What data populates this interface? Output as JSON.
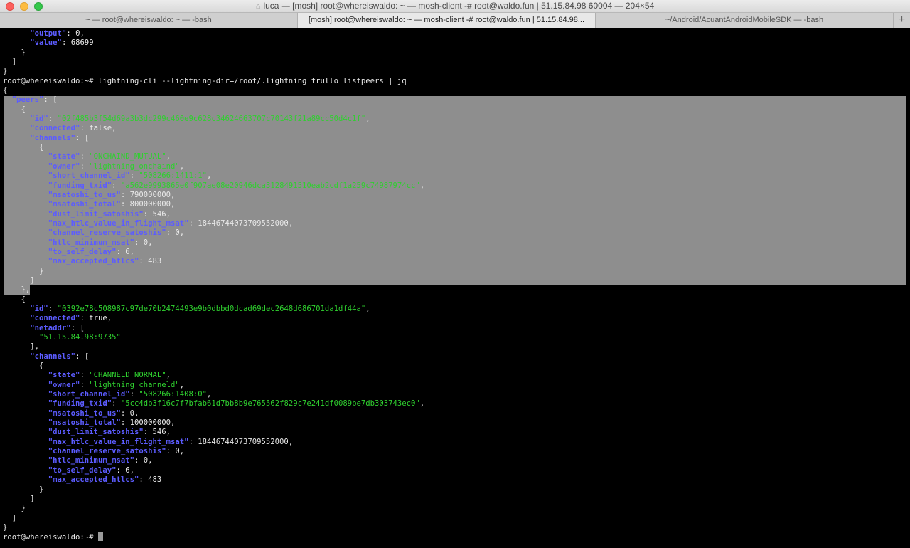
{
  "window": {
    "title": "luca — [mosh] root@whereiswaldo: ~ — mosh-client -# root@waldo.fun | 51.15.84.98 60004 — 204×54"
  },
  "tabs": [
    {
      "label": "~ — root@whereiswaldo: ~ — -bash",
      "active": false
    },
    {
      "label": "[mosh] root@whereiswaldo: ~ — mosh-client -# root@waldo.fun | 51.15.84.98...",
      "active": true
    },
    {
      "label": "~/Android/AcuantAndroidMobileSDK — -bash",
      "active": false
    }
  ],
  "new_tab_label": "+",
  "icons": {
    "title": "home-icon",
    "cursor": "block-cursor"
  },
  "colors": {
    "key": "#5c5cff",
    "string": "#2fd02f",
    "selection": "#8e8e8e"
  },
  "terminal": {
    "lines": [
      [
        {
          "t": "      "
        },
        {
          "t": "\"output\"",
          "c": "k"
        },
        {
          "t": ": 0,"
        }
      ],
      [
        {
          "t": "      "
        },
        {
          "t": "\"value\"",
          "c": "k"
        },
        {
          "t": ": 68699"
        }
      ],
      [
        {
          "t": "    }"
        }
      ],
      [
        {
          "t": "  ]"
        }
      ],
      [
        {
          "t": "}"
        }
      ],
      [
        {
          "t": "root@whereiswaldo:~# lightning-cli --lightning-dir=/root/.lightning_trullo listpeers | jq"
        }
      ],
      [
        {
          "t": "{"
        }
      ],
      [
        {
          "t": "  "
        },
        {
          "t": "\"peers\"",
          "c": "k"
        },
        {
          "t": ": ["
        }
      ],
      [
        {
          "t": "    {"
        }
      ],
      [
        {
          "t": "      "
        },
        {
          "t": "\"id\"",
          "c": "k"
        },
        {
          "t": ": "
        },
        {
          "t": "\"02f485b3f54d69a3b3dc299c460e9c628c34624663707c70143f21a89cc50d4c1f\"",
          "c": "s"
        },
        {
          "t": ","
        }
      ],
      [
        {
          "t": "      "
        },
        {
          "t": "\"connected\"",
          "c": "k"
        },
        {
          "t": ": false,"
        }
      ],
      [
        {
          "t": "      "
        },
        {
          "t": "\"channels\"",
          "c": "k"
        },
        {
          "t": ": ["
        }
      ],
      [
        {
          "t": "        {"
        }
      ],
      [
        {
          "t": "          "
        },
        {
          "t": "\"state\"",
          "c": "k"
        },
        {
          "t": ": "
        },
        {
          "t": "\"ONCHAIND_MUTUAL\"",
          "c": "s"
        },
        {
          "t": ","
        }
      ],
      [
        {
          "t": "          "
        },
        {
          "t": "\"owner\"",
          "c": "k"
        },
        {
          "t": ": "
        },
        {
          "t": "\"lightning_onchaind\"",
          "c": "s"
        },
        {
          "t": ","
        }
      ],
      [
        {
          "t": "          "
        },
        {
          "t": "\"short_channel_id\"",
          "c": "k"
        },
        {
          "t": ": "
        },
        {
          "t": "\"508266:1411:1\"",
          "c": "s"
        },
        {
          "t": ","
        }
      ],
      [
        {
          "t": "          "
        },
        {
          "t": "\"funding_txid\"",
          "c": "k"
        },
        {
          "t": ": "
        },
        {
          "t": "\"a562e9993865e0f907ae08e20946dca3128491510eab2cdf1a259c74987974cc\"",
          "c": "s"
        },
        {
          "t": ","
        }
      ],
      [
        {
          "t": "          "
        },
        {
          "t": "\"msatoshi_to_us\"",
          "c": "k"
        },
        {
          "t": ": 790000000,"
        }
      ],
      [
        {
          "t": "          "
        },
        {
          "t": "\"msatoshi_total\"",
          "c": "k"
        },
        {
          "t": ": 800000000,"
        }
      ],
      [
        {
          "t": "          "
        },
        {
          "t": "\"dust_limit_satoshis\"",
          "c": "k"
        },
        {
          "t": ": 546,"
        }
      ],
      [
        {
          "t": "          "
        },
        {
          "t": "\"max_htlc_value_in_flight_msat\"",
          "c": "k"
        },
        {
          "t": ": 18446744073709552000,"
        }
      ],
      [
        {
          "t": "          "
        },
        {
          "t": "\"channel_reserve_satoshis\"",
          "c": "k"
        },
        {
          "t": ": 0,"
        }
      ],
      [
        {
          "t": "          "
        },
        {
          "t": "\"htlc_minimum_msat\"",
          "c": "k"
        },
        {
          "t": ": 0,"
        }
      ],
      [
        {
          "t": "          "
        },
        {
          "t": "\"to_self_delay\"",
          "c": "k"
        },
        {
          "t": ": 6,"
        }
      ],
      [
        {
          "t": "          "
        },
        {
          "t": "\"max_accepted_htlcs\"",
          "c": "k"
        },
        {
          "t": ": 483"
        }
      ],
      [
        {
          "t": "        }"
        }
      ],
      [
        {
          "t": "      ]"
        }
      ],
      [
        {
          "t": "    },"
        }
      ],
      [
        {
          "t": "    {"
        }
      ],
      [
        {
          "t": "      "
        },
        {
          "t": "\"id\"",
          "c": "k"
        },
        {
          "t": ": "
        },
        {
          "t": "\"0392e78c508987c97de70b2474493e9b0dbbd0dcad69dec2648d686701da1df44a\"",
          "c": "s"
        },
        {
          "t": ","
        }
      ],
      [
        {
          "t": "      "
        },
        {
          "t": "\"connected\"",
          "c": "k"
        },
        {
          "t": ": true,"
        }
      ],
      [
        {
          "t": "      "
        },
        {
          "t": "\"netaddr\"",
          "c": "k"
        },
        {
          "t": ": ["
        }
      ],
      [
        {
          "t": "        "
        },
        {
          "t": "\"51.15.84.98:9735\"",
          "c": "s"
        }
      ],
      [
        {
          "t": "      ],"
        }
      ],
      [
        {
          "t": "      "
        },
        {
          "t": "\"channels\"",
          "c": "k"
        },
        {
          "t": ": ["
        }
      ],
      [
        {
          "t": "        {"
        }
      ],
      [
        {
          "t": "          "
        },
        {
          "t": "\"state\"",
          "c": "k"
        },
        {
          "t": ": "
        },
        {
          "t": "\"CHANNELD_NORMAL\"",
          "c": "s"
        },
        {
          "t": ","
        }
      ],
      [
        {
          "t": "          "
        },
        {
          "t": "\"owner\"",
          "c": "k"
        },
        {
          "t": ": "
        },
        {
          "t": "\"lightning_channeld\"",
          "c": "s"
        },
        {
          "t": ","
        }
      ],
      [
        {
          "t": "          "
        },
        {
          "t": "\"short_channel_id\"",
          "c": "k"
        },
        {
          "t": ": "
        },
        {
          "t": "\"508266:1408:0\"",
          "c": "s"
        },
        {
          "t": ","
        }
      ],
      [
        {
          "t": "          "
        },
        {
          "t": "\"funding_txid\"",
          "c": "k"
        },
        {
          "t": ": "
        },
        {
          "t": "\"5cc4db3f16c7f7bfab61d7bb8b9e765562f829c7e241df0089be7db303743ec0\"",
          "c": "s"
        },
        {
          "t": ","
        }
      ],
      [
        {
          "t": "          "
        },
        {
          "t": "\"msatoshi_to_us\"",
          "c": "k"
        },
        {
          "t": ": 0,"
        }
      ],
      [
        {
          "t": "          "
        },
        {
          "t": "\"msatoshi_total\"",
          "c": "k"
        },
        {
          "t": ": 100000000,"
        }
      ],
      [
        {
          "t": "          "
        },
        {
          "t": "\"dust_limit_satoshis\"",
          "c": "k"
        },
        {
          "t": ": 546,"
        }
      ],
      [
        {
          "t": "          "
        },
        {
          "t": "\"max_htlc_value_in_flight_msat\"",
          "c": "k"
        },
        {
          "t": ": 18446744073709552000,"
        }
      ],
      [
        {
          "t": "          "
        },
        {
          "t": "\"channel_reserve_satoshis\"",
          "c": "k"
        },
        {
          "t": ": 0,"
        }
      ],
      [
        {
          "t": "          "
        },
        {
          "t": "\"htlc_minimum_msat\"",
          "c": "k"
        },
        {
          "t": ": 0,"
        }
      ],
      [
        {
          "t": "          "
        },
        {
          "t": "\"to_self_delay\"",
          "c": "k"
        },
        {
          "t": ": 6,"
        }
      ],
      [
        {
          "t": "          "
        },
        {
          "t": "\"max_accepted_htlcs\"",
          "c": "k"
        },
        {
          "t": ": 483"
        }
      ],
      [
        {
          "t": "        }"
        }
      ],
      [
        {
          "t": "      ]"
        }
      ],
      [
        {
          "t": "    }"
        }
      ],
      [
        {
          "t": "  ]"
        }
      ],
      [
        {
          "t": "}"
        }
      ],
      [
        {
          "t": "root@whereiswaldo:~# "
        }
      ]
    ]
  }
}
